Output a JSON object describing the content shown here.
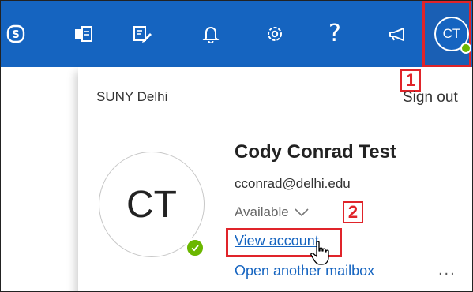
{
  "topbar": {
    "icons": [
      "skype-icon",
      "teams-icon",
      "tasks-icon",
      "bell-icon",
      "settings-icon",
      "help-icon",
      "feedback-icon"
    ],
    "help_glyph": "?",
    "avatar_initials": "CT",
    "bg_color": "#1564c0"
  },
  "annotations": {
    "step1": "1",
    "step2": "2",
    "color": "#e0242a"
  },
  "account_panel": {
    "org": "SUNY Delhi",
    "sign_out": "Sign out",
    "initials": "CT",
    "name": "Cody Conrad Test",
    "email": "cconrad@delhi.edu",
    "status": "Available",
    "view_account": "View account",
    "open_mailbox": "Open another mailbox",
    "more": "...",
    "presence_color": "#6bb700"
  }
}
